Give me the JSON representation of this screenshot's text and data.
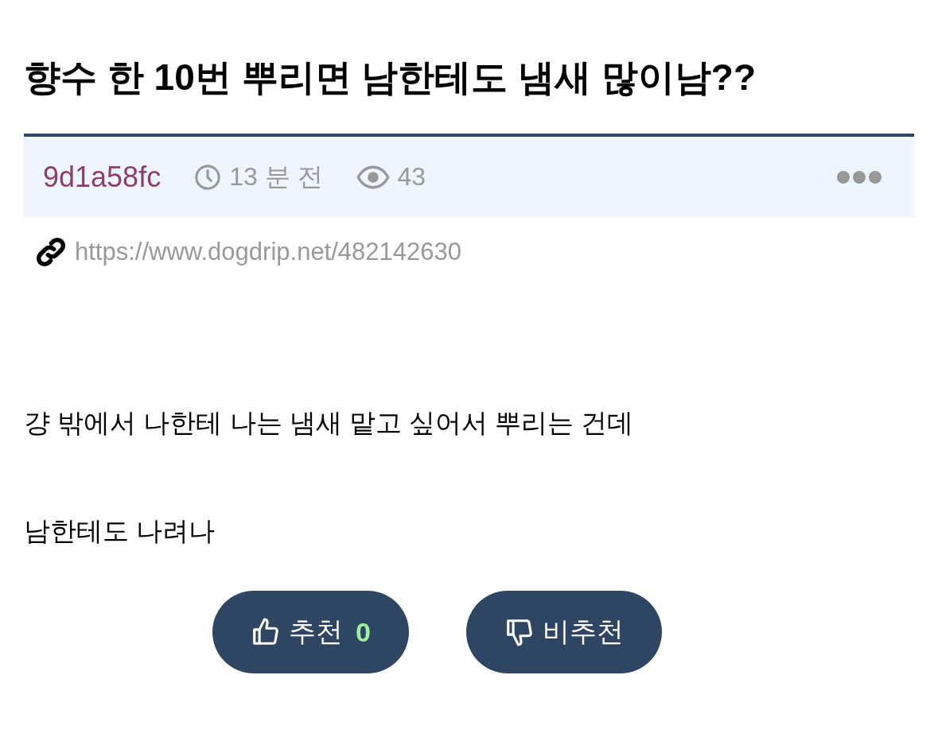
{
  "title": "향수 한 10번 뿌리면 남한테도 냄새 많이남??",
  "meta": {
    "author": "9d1a58fc",
    "time": "13 분 전",
    "views": "43"
  },
  "link": "https://www.dogdrip.net/482142630",
  "body": [
    "걍 밖에서 나한테 나는 냄새 맡고 싶어서 뿌리는 건데",
    "남한테도 나려나"
  ],
  "votes": [
    {
      "kind": "up",
      "label": "추천",
      "count": "0"
    },
    {
      "kind": "down",
      "label": "비추천"
    }
  ]
}
